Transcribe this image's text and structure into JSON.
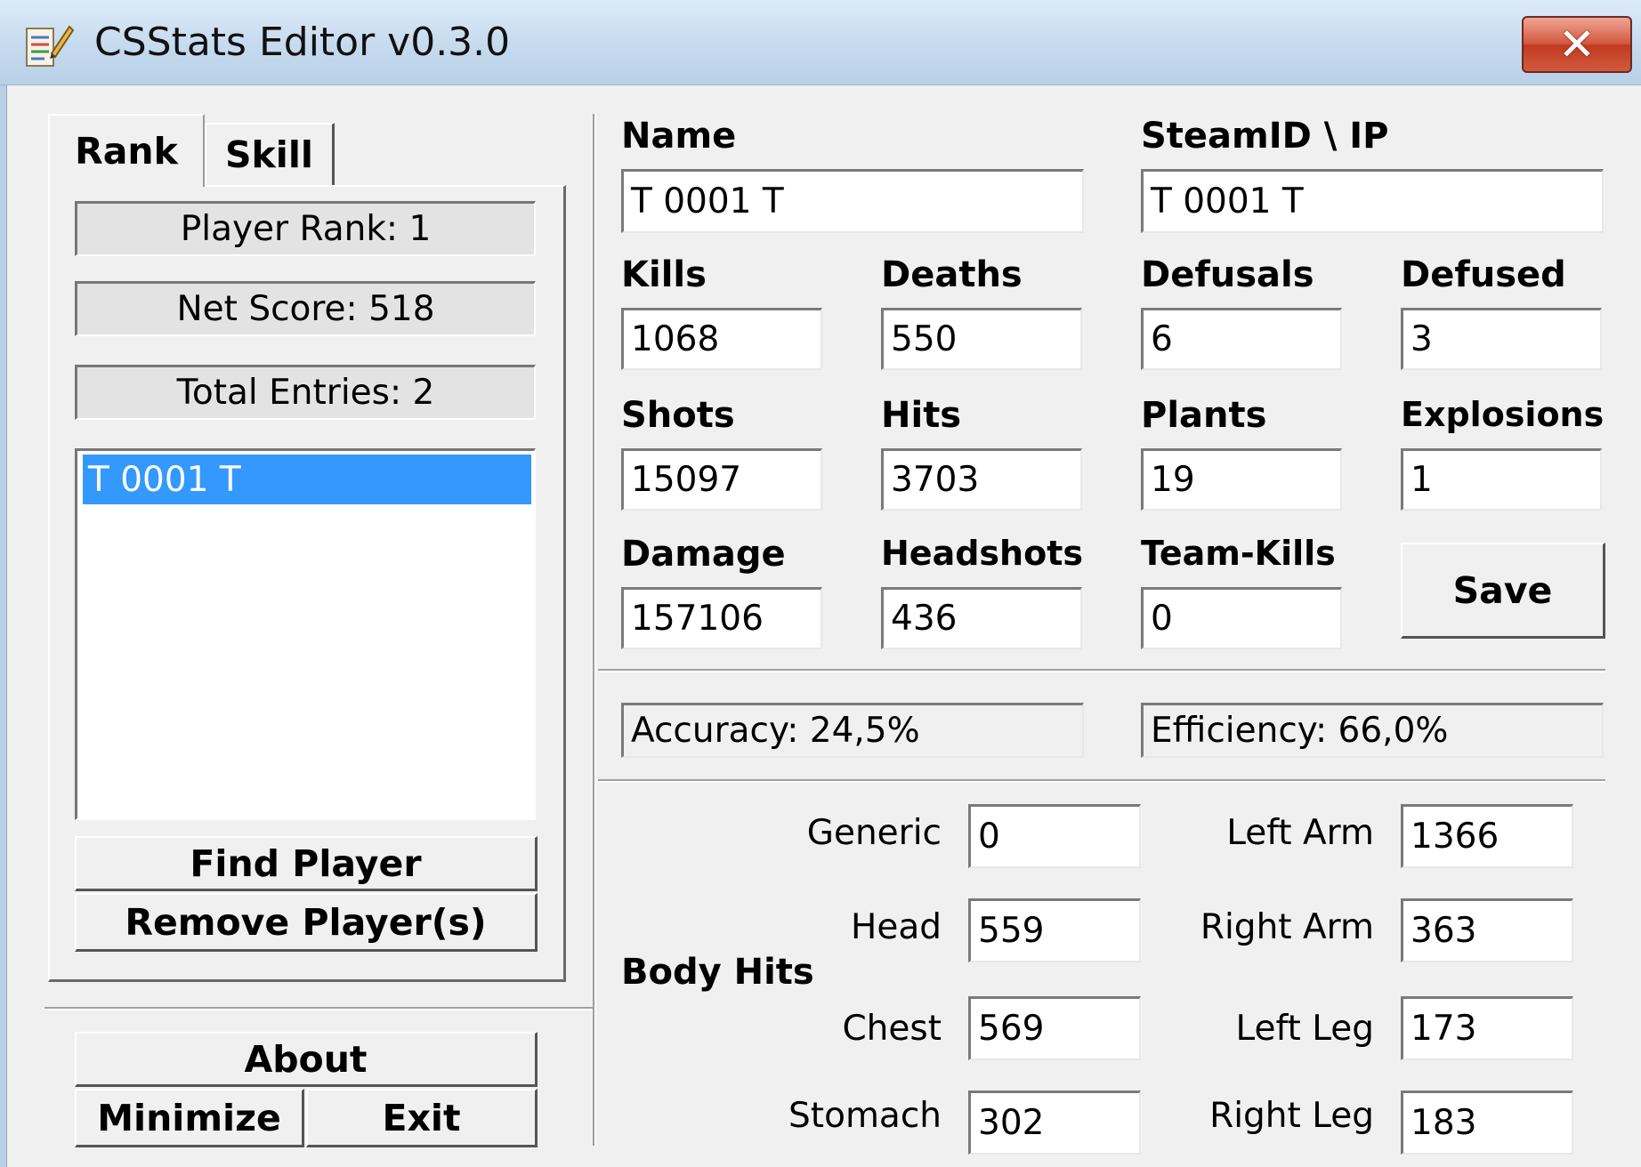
{
  "window": {
    "title": "CSStats Editor v0.3.0",
    "close_glyph": "✕"
  },
  "tabs": {
    "rank": "Rank",
    "skill": "Skill"
  },
  "rank_panel": {
    "player_rank": "Player Rank: 1",
    "net_score": "Net Score: 518",
    "total_entries": "Total Entries: 2",
    "players": [
      "T 0001 T"
    ],
    "find_player": "Find Player",
    "remove_players": "Remove Player(s)"
  },
  "bottom_buttons": {
    "about": "About",
    "minimize": "Minimize",
    "exit": "Exit"
  },
  "player": {
    "name_label": "Name",
    "name": "T 0001 T",
    "steamid_label": "SteamID \\ IP",
    "steamid": "T 0001 T"
  },
  "stats": {
    "kills": {
      "label": "Kills",
      "value": "1068"
    },
    "deaths": {
      "label": "Deaths",
      "value": "550"
    },
    "defusals": {
      "label": "Defusals",
      "value": "6"
    },
    "defused": {
      "label": "Defused",
      "value": "3"
    },
    "shots": {
      "label": "Shots",
      "value": "15097"
    },
    "hits": {
      "label": "Hits",
      "value": "3703"
    },
    "plants": {
      "label": "Plants",
      "value": "19"
    },
    "explosions": {
      "label": "Explosions",
      "value": "1"
    },
    "damage": {
      "label": "Damage",
      "value": "157106"
    },
    "headshots": {
      "label": "Headshots",
      "value": "436"
    },
    "teamkills": {
      "label": "Team-Kills",
      "value": "0"
    }
  },
  "save_label": "Save",
  "accuracy": "Accuracy: 24,5%",
  "efficiency": "Efficiency: 66,0%",
  "body_hits": {
    "title": "Body Hits",
    "generic": {
      "label": "Generic",
      "value": "0"
    },
    "head": {
      "label": "Head",
      "value": "559"
    },
    "chest": {
      "label": "Chest",
      "value": "569"
    },
    "stomach": {
      "label": "Stomach",
      "value": "302"
    },
    "left_arm": {
      "label": "Left Arm",
      "value": "1366"
    },
    "right_arm": {
      "label": "Right Arm",
      "value": "363"
    },
    "left_leg": {
      "label": "Left Leg",
      "value": "173"
    },
    "right_leg": {
      "label": "Right Leg",
      "value": "183"
    }
  },
  "colors": {
    "selection": "#3399ff",
    "titlebar": "#c6daee",
    "close_button": "#c13a22",
    "window_bg": "#f0f0f0"
  }
}
